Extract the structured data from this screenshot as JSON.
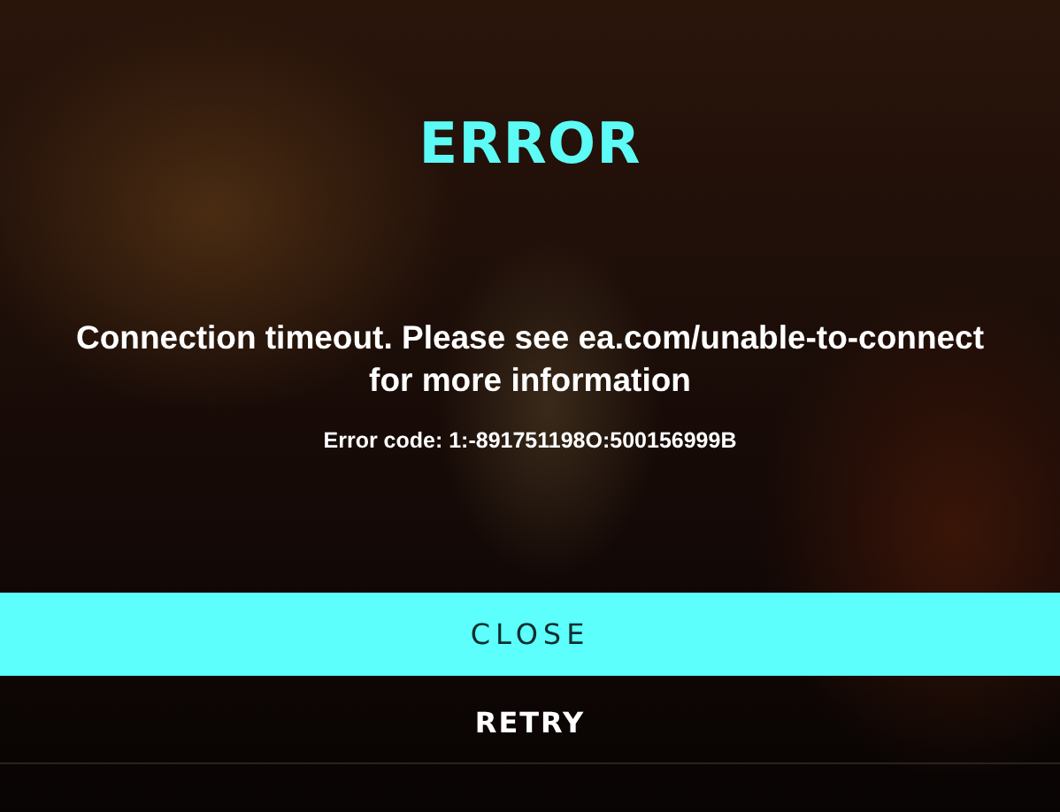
{
  "dialog": {
    "title": "ERROR",
    "message": "Connection timeout. Please see ea.com/unable-to-connect for more information",
    "error_code": "Error code: 1:-891751198O:500156999B"
  },
  "buttons": [
    {
      "label": "CLOSE",
      "selected": true
    },
    {
      "label": "RETRY",
      "selected": false
    }
  ]
}
